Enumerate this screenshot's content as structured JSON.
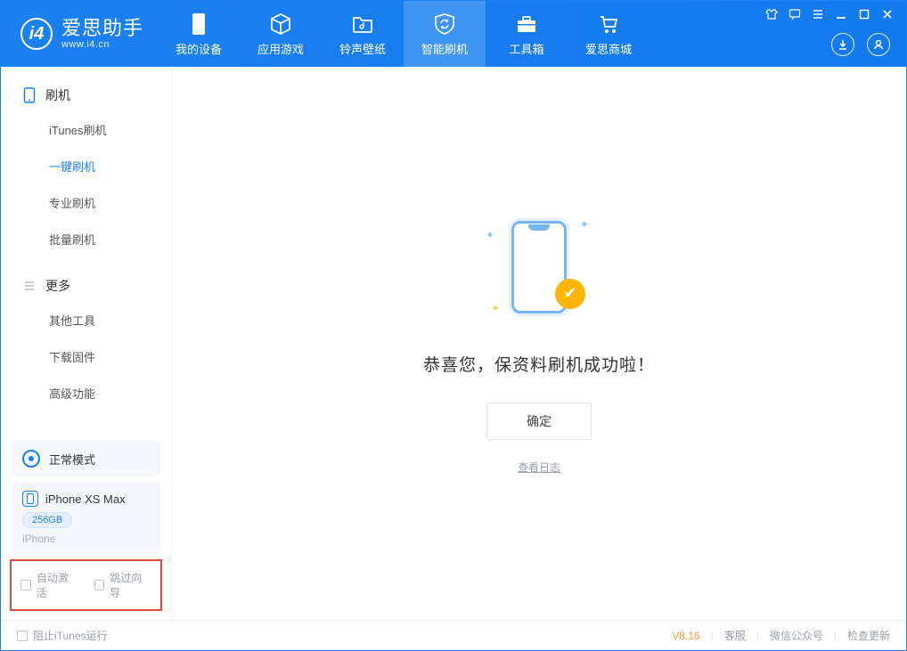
{
  "app": {
    "title": "爱思助手",
    "subtitle": "www.i4.cn"
  },
  "nav": {
    "items": [
      {
        "label": "我的设备"
      },
      {
        "label": "应用游戏"
      },
      {
        "label": "铃声壁纸"
      },
      {
        "label": "智能刷机"
      },
      {
        "label": "工具箱"
      },
      {
        "label": "爱思商城"
      }
    ],
    "active_index": 3
  },
  "sidebar": {
    "group1": {
      "title": "刷机",
      "items": [
        {
          "label": "iTunes刷机"
        },
        {
          "label": "一键刷机"
        },
        {
          "label": "专业刷机"
        },
        {
          "label": "批量刷机"
        }
      ],
      "active_index": 1
    },
    "group2": {
      "title": "更多",
      "items": [
        {
          "label": "其他工具"
        },
        {
          "label": "下载固件"
        },
        {
          "label": "高级功能"
        }
      ]
    },
    "mode_label": "正常模式",
    "device": {
      "name": "iPhone XS Max",
      "storage": "256GB",
      "type": "iPhone"
    },
    "check_auto_activate": "自动激活",
    "check_skip_guide": "跳过向导"
  },
  "main": {
    "success_message": "恭喜您，保资料刷机成功啦！",
    "ok_button": "确定",
    "log_link": "查看日志"
  },
  "statusbar": {
    "block_itunes": "阻止iTunes运行",
    "version": "V8.16",
    "links": [
      "客服",
      "微信公众号",
      "检查更新"
    ]
  }
}
